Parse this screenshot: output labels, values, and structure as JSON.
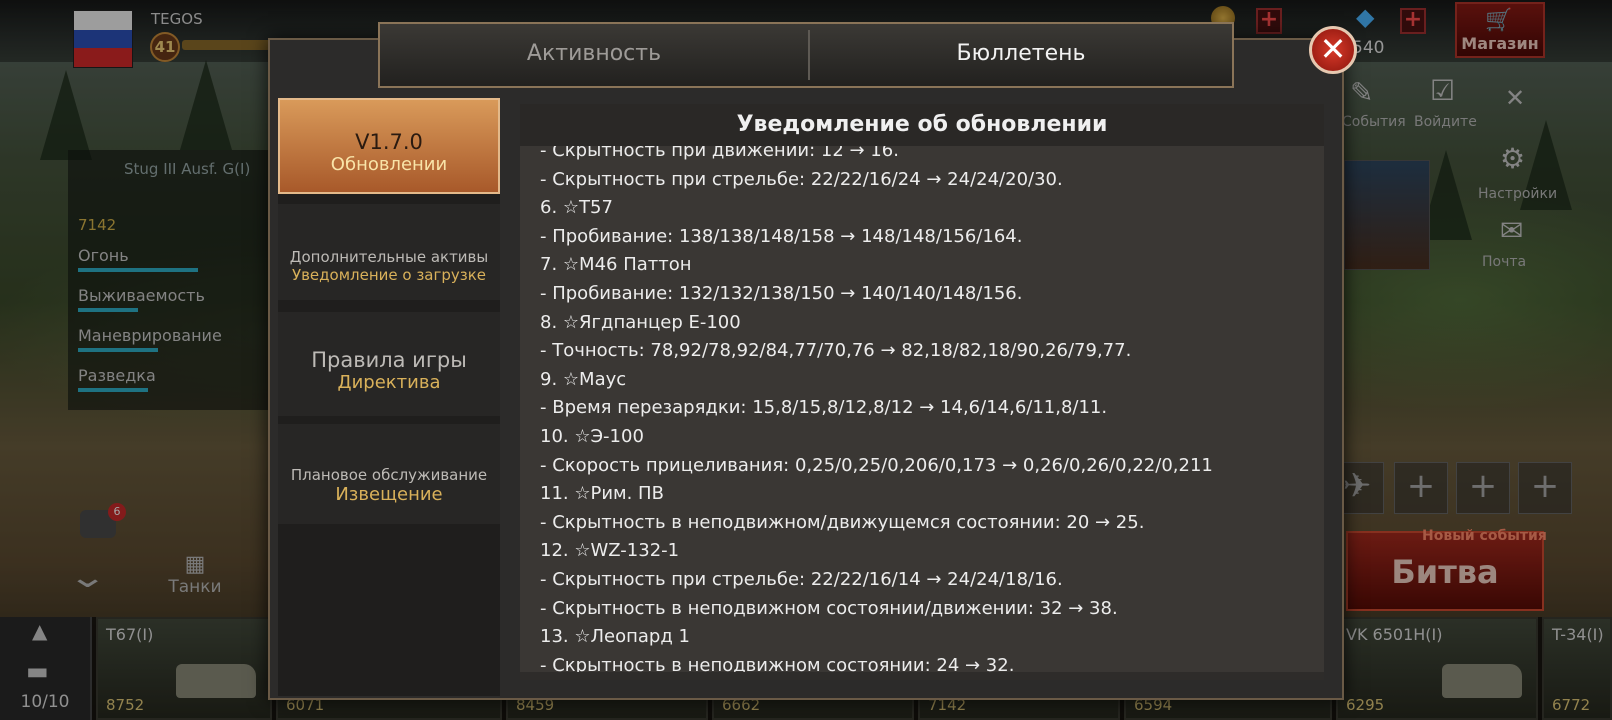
{
  "player": {
    "name": "TEGOS",
    "level": "41",
    "gems": "540"
  },
  "shop": {
    "label": "Магазин",
    "icon": "cart-icon"
  },
  "tank_stats": {
    "name": "Stug III Ausf. G(I)",
    "price": "7142",
    "rows": [
      {
        "label": "Огонь"
      },
      {
        "label": "Выживаемость"
      },
      {
        "label": "Маневрирование"
      },
      {
        "label": "Разведка"
      }
    ]
  },
  "chat": {
    "badge": "6"
  },
  "nav": {
    "tanks_label": "Танки"
  },
  "garage": {
    "count": "10/10"
  },
  "carousel": [
    {
      "name": "T67(I)",
      "price": "8752"
    },
    {
      "name": "",
      "price": "6071"
    },
    {
      "name": "",
      "price": "8459"
    },
    {
      "name": "",
      "price": "6662"
    },
    {
      "name": "",
      "price": "7142"
    },
    {
      "name": "",
      "price": "6594"
    },
    {
      "name": "VK 6501H(I)",
      "price": "6295"
    },
    {
      "name": "T-34(I)",
      "price": "6772"
    }
  ],
  "side_menu": {
    "events": "События",
    "login": "Войдите",
    "settings": "Настройки",
    "mail": "Почта"
  },
  "battle": {
    "label": "Битва",
    "tag": "Новый события"
  },
  "modal": {
    "tabs": {
      "activity": "Активность",
      "bulletin": "Бюллетень"
    },
    "sidebar": [
      {
        "title": "V1.7.0",
        "subtitle": "Обновлении",
        "active": true
      },
      {
        "title": "Дополнительные активы",
        "subtitle": "Уведомление о загрузке",
        "active": false
      },
      {
        "title": "Правила игры",
        "subtitle": "Директива",
        "active": false
      },
      {
        "title": "Плановое обслуживание",
        "subtitle": "Извещение",
        "active": false
      }
    ],
    "content_title": "Уведомление об обновлении",
    "notes": [
      "- Скрытность при движении: 12 → 16.",
      "- Скрытность при стрельбе: 22/22/16/24 → 24/24/20/30.",
      "6. ☆T57",
      "- Пробивание: 138/138/148/158 → 148/148/156/164.",
      "7. ☆M46 Паттон",
      "- Пробивание: 132/132/138/150 → 140/140/148/156.",
      "8. ☆Ягдпанцер Е-100",
      "- Точность: 78,92/78,92/84,77/70,76 → 82,18/82,18/90,26/79,77.",
      "9. ☆Маус",
      "- Время перезарядки: 15,8/15,8/12,8/12 → 14,6/14,6/11,8/11.",
      "10. ☆Э-100",
      "- Скорость прицеливания: 0,25/0,25/0,206/0,173 → 0,26/0,26/0,22/0,211",
      "11. ☆Рим. ПВ",
      "- Скрытность в неподвижном/движущемся состоянии: 20 → 25.",
      "12. ☆WZ-132-1",
      "- Скрытность при стрельбе: 22/22/16/14 → 24/24/18/16.",
      "- Скрытность в неподвижном состоянии/движении: 32 → 38.",
      "13. ☆Леопард 1",
      "- Скрытность в неподвижном состоянии: 24 → 32."
    ]
  }
}
